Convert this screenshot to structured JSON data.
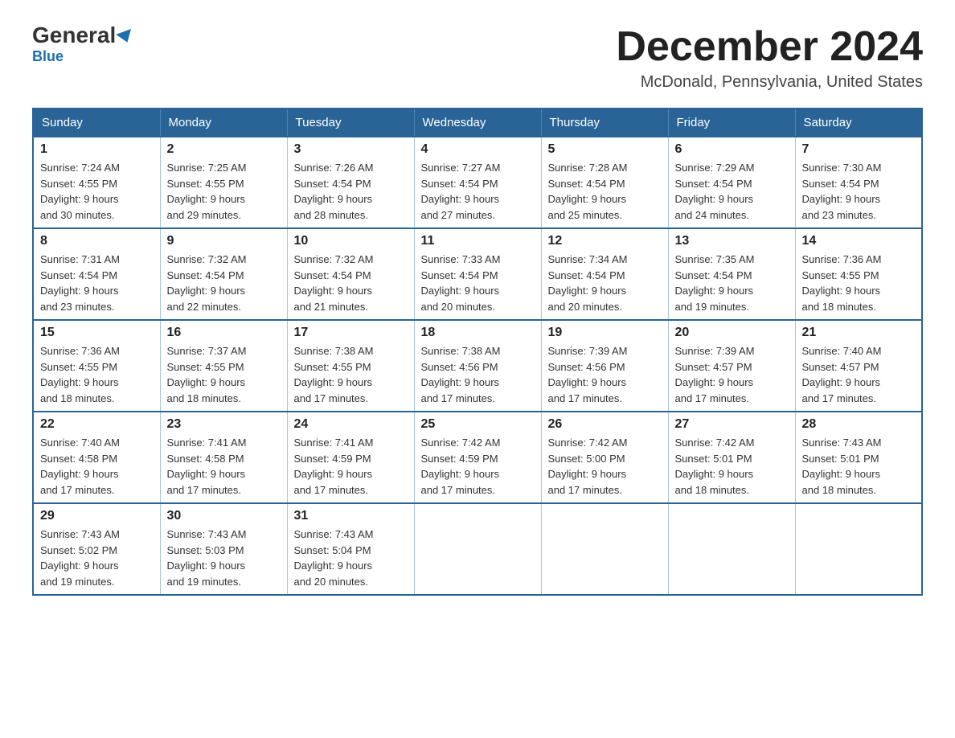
{
  "header": {
    "logo_main": "General",
    "logo_sub": "Blue",
    "month_title": "December 2024",
    "location": "McDonald, Pennsylvania, United States"
  },
  "days_of_week": [
    "Sunday",
    "Monday",
    "Tuesday",
    "Wednesday",
    "Thursday",
    "Friday",
    "Saturday"
  ],
  "weeks": [
    [
      {
        "day": "1",
        "sunrise": "7:24 AM",
        "sunset": "4:55 PM",
        "daylight": "9 hours and 30 minutes."
      },
      {
        "day": "2",
        "sunrise": "7:25 AM",
        "sunset": "4:55 PM",
        "daylight": "9 hours and 29 minutes."
      },
      {
        "day": "3",
        "sunrise": "7:26 AM",
        "sunset": "4:54 PM",
        "daylight": "9 hours and 28 minutes."
      },
      {
        "day": "4",
        "sunrise": "7:27 AM",
        "sunset": "4:54 PM",
        "daylight": "9 hours and 27 minutes."
      },
      {
        "day": "5",
        "sunrise": "7:28 AM",
        "sunset": "4:54 PM",
        "daylight": "9 hours and 25 minutes."
      },
      {
        "day": "6",
        "sunrise": "7:29 AM",
        "sunset": "4:54 PM",
        "daylight": "9 hours and 24 minutes."
      },
      {
        "day": "7",
        "sunrise": "7:30 AM",
        "sunset": "4:54 PM",
        "daylight": "9 hours and 23 minutes."
      }
    ],
    [
      {
        "day": "8",
        "sunrise": "7:31 AM",
        "sunset": "4:54 PM",
        "daylight": "9 hours and 23 minutes."
      },
      {
        "day": "9",
        "sunrise": "7:32 AM",
        "sunset": "4:54 PM",
        "daylight": "9 hours and 22 minutes."
      },
      {
        "day": "10",
        "sunrise": "7:32 AM",
        "sunset": "4:54 PM",
        "daylight": "9 hours and 21 minutes."
      },
      {
        "day": "11",
        "sunrise": "7:33 AM",
        "sunset": "4:54 PM",
        "daylight": "9 hours and 20 minutes."
      },
      {
        "day": "12",
        "sunrise": "7:34 AM",
        "sunset": "4:54 PM",
        "daylight": "9 hours and 20 minutes."
      },
      {
        "day": "13",
        "sunrise": "7:35 AM",
        "sunset": "4:54 PM",
        "daylight": "9 hours and 19 minutes."
      },
      {
        "day": "14",
        "sunrise": "7:36 AM",
        "sunset": "4:55 PM",
        "daylight": "9 hours and 18 minutes."
      }
    ],
    [
      {
        "day": "15",
        "sunrise": "7:36 AM",
        "sunset": "4:55 PM",
        "daylight": "9 hours and 18 minutes."
      },
      {
        "day": "16",
        "sunrise": "7:37 AM",
        "sunset": "4:55 PM",
        "daylight": "9 hours and 18 minutes."
      },
      {
        "day": "17",
        "sunrise": "7:38 AM",
        "sunset": "4:55 PM",
        "daylight": "9 hours and 17 minutes."
      },
      {
        "day": "18",
        "sunrise": "7:38 AM",
        "sunset": "4:56 PM",
        "daylight": "9 hours and 17 minutes."
      },
      {
        "day": "19",
        "sunrise": "7:39 AM",
        "sunset": "4:56 PM",
        "daylight": "9 hours and 17 minutes."
      },
      {
        "day": "20",
        "sunrise": "7:39 AM",
        "sunset": "4:57 PM",
        "daylight": "9 hours and 17 minutes."
      },
      {
        "day": "21",
        "sunrise": "7:40 AM",
        "sunset": "4:57 PM",
        "daylight": "9 hours and 17 minutes."
      }
    ],
    [
      {
        "day": "22",
        "sunrise": "7:40 AM",
        "sunset": "4:58 PM",
        "daylight": "9 hours and 17 minutes."
      },
      {
        "day": "23",
        "sunrise": "7:41 AM",
        "sunset": "4:58 PM",
        "daylight": "9 hours and 17 minutes."
      },
      {
        "day": "24",
        "sunrise": "7:41 AM",
        "sunset": "4:59 PM",
        "daylight": "9 hours and 17 minutes."
      },
      {
        "day": "25",
        "sunrise": "7:42 AM",
        "sunset": "4:59 PM",
        "daylight": "9 hours and 17 minutes."
      },
      {
        "day": "26",
        "sunrise": "7:42 AM",
        "sunset": "5:00 PM",
        "daylight": "9 hours and 17 minutes."
      },
      {
        "day": "27",
        "sunrise": "7:42 AM",
        "sunset": "5:01 PM",
        "daylight": "9 hours and 18 minutes."
      },
      {
        "day": "28",
        "sunrise": "7:43 AM",
        "sunset": "5:01 PM",
        "daylight": "9 hours and 18 minutes."
      }
    ],
    [
      {
        "day": "29",
        "sunrise": "7:43 AM",
        "sunset": "5:02 PM",
        "daylight": "9 hours and 19 minutes."
      },
      {
        "day": "30",
        "sunrise": "7:43 AM",
        "sunset": "5:03 PM",
        "daylight": "9 hours and 19 minutes."
      },
      {
        "day": "31",
        "sunrise": "7:43 AM",
        "sunset": "5:04 PM",
        "daylight": "9 hours and 20 minutes."
      },
      null,
      null,
      null,
      null
    ]
  ],
  "labels": {
    "sunrise": "Sunrise:",
    "sunset": "Sunset:",
    "daylight": "Daylight:"
  }
}
